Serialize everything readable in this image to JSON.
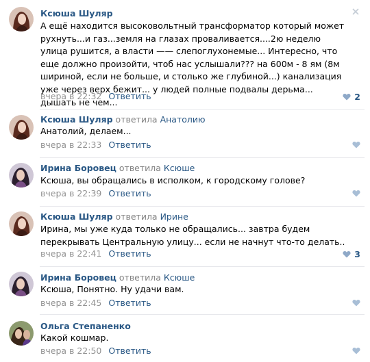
{
  "comments": [
    {
      "author": "Ксюша Шуляр",
      "reply_word": "",
      "reply_to": "",
      "text": "А ещё находится высоковольтный трансформатор который может рухнуть...и газ...земля на глазах проваливается....2ю неделю улица рушится, а власти —— слепоглухонемые... Интересно, что еще должно произойти, чтоб нас услышали??? на 600м - 8 ям (8м шириной, если не больше, и столько же глубиной...) канализация уже через верх бежит... у людей полные подвалы дерьма... дышать не чем...",
      "date": "вчера в 22:32",
      "reply_label": "Ответить",
      "likes": "2"
    },
    {
      "author": "Ксюша Шуляр",
      "reply_word": "ответила",
      "reply_to": "Анатолию",
      "text": "Анатолий, делаем...",
      "date": "вчера в 22:33",
      "reply_label": "Ответить",
      "likes": ""
    },
    {
      "author": "Ирина Боровец",
      "reply_word": "ответила",
      "reply_to": "Ксюше",
      "text": "Ксюша, вы обращались в исполком, к городскому голове?",
      "date": "вчера в 22:39",
      "reply_label": "Ответить",
      "likes": ""
    },
    {
      "author": "Ксюша Шуляр",
      "reply_word": "ответила",
      "reply_to": "Ирине",
      "text": "Ирина, мы уже куда только не обращались... завтра будем перекрывать Центральную улицу... если не начнут что-то делать..",
      "date": "вчера в 22:41",
      "reply_label": "Ответить",
      "likes": "3"
    },
    {
      "author": "Ирина Боровец",
      "reply_word": "ответила",
      "reply_to": "Ксюше",
      "text": "Ксюша, Понятно. Ну удачи вам.",
      "date": "вчера в 22:45",
      "reply_label": "Ответить",
      "likes": ""
    },
    {
      "author": "Ольга Степаненко",
      "reply_word": "",
      "reply_to": "",
      "text": "Какой кошмар.",
      "date": "вчера в 22:50",
      "reply_label": "Ответить",
      "likes": ""
    }
  ],
  "colors": {
    "link": "#2a5885",
    "muted": "#828282",
    "like_icon": "#a8bed6",
    "like_icon_active": "#8fa9c8",
    "divider": "#e7e8ec"
  },
  "icons": {
    "like": "heart-icon",
    "close": "close-icon"
  }
}
